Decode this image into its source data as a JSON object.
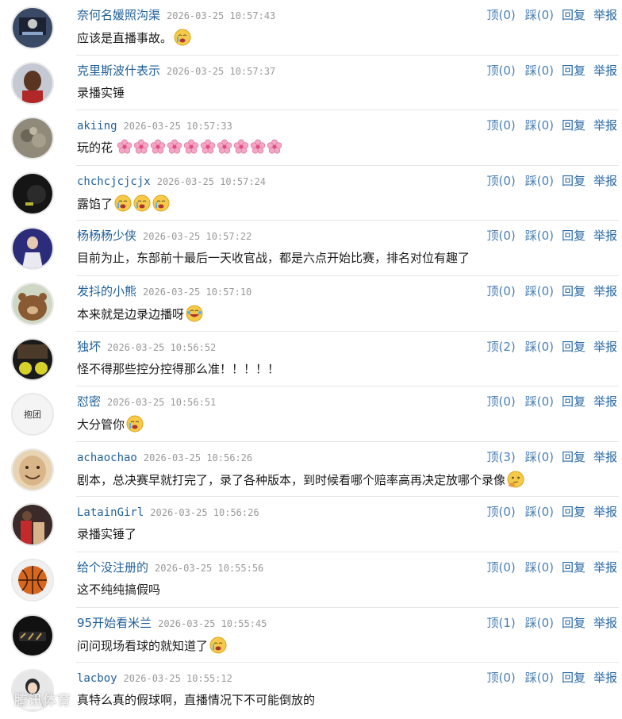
{
  "comments": [
    {
      "user": "奈何名媛照沟渠",
      "time": "2026-03-25 10:57:43",
      "text": "应该是直播事故。",
      "up": "顶(0)",
      "down": "踩(0)",
      "reply": "回复",
      "report": "举报"
    },
    {
      "user": "克里斯波什表示",
      "time": "2026-03-25 10:57:37",
      "text": "录播实锤",
      "up": "顶(0)",
      "down": "踩(0)",
      "reply": "回复",
      "report": "举报"
    },
    {
      "user": "akiing",
      "time": "2026-03-25 10:57:33",
      "text": "玩的花",
      "up": "顶(0)",
      "down": "踩(0)",
      "reply": "回复",
      "report": "举报"
    },
    {
      "user": "chchcjcjcjx",
      "time": "2026-03-25 10:57:24",
      "text": "露馅了",
      "up": "顶(0)",
      "down": "踩(0)",
      "reply": "回复",
      "report": "举报"
    },
    {
      "user": "杨杨杨少侠",
      "time": "2026-03-25 10:57:22",
      "text": "目前为止，东部前十最后一天收官战，都是六点开始比赛，排名对位有趣了",
      "up": "顶(0)",
      "down": "踩(0)",
      "reply": "回复",
      "report": "举报"
    },
    {
      "user": "发抖的小熊",
      "time": "2026-03-25 10:57:10",
      "text": "本来就是边录边播呀",
      "up": "顶(0)",
      "down": "踩(0)",
      "reply": "回复",
      "report": "举报"
    },
    {
      "user": "独坏",
      "time": "2026-03-25 10:56:52",
      "text": "怪不得那些控分控得那么准！！！！！",
      "up": "顶(2)",
      "down": "踩(0)",
      "reply": "回复",
      "report": "举报"
    },
    {
      "user": "怼密",
      "time": "2026-03-25 10:56:51",
      "text": "大分管你",
      "up": "顶(0)",
      "down": "踩(0)",
      "reply": "回复",
      "report": "举报",
      "avatar_text": "抱团"
    },
    {
      "user": "achaochao",
      "time": "2026-03-25 10:56:26",
      "text": "剧本，总决赛早就打完了，录了各种版本，到时候看哪个赔率高再决定放哪个录像",
      "up": "顶(3)",
      "down": "踩(0)",
      "reply": "回复",
      "report": "举报"
    },
    {
      "user": "LatainGirl",
      "time": "2026-03-25 10:56:26",
      "text": "录播实锤了",
      "up": "顶(0)",
      "down": "踩(0)",
      "reply": "回复",
      "report": "举报"
    },
    {
      "user": "给个没注册的",
      "time": "2026-03-25 10:55:56",
      "text": "这不纯纯搞假吗",
      "up": "顶(0)",
      "down": "踩(0)",
      "reply": "回复",
      "report": "举报"
    },
    {
      "user": "95开始看米兰",
      "time": "2026-03-25 10:55:45",
      "text": "问问现场看球的就知道了",
      "up": "顶(1)",
      "down": "踩(0)",
      "reply": "回复",
      "report": "举报"
    },
    {
      "user": "lacboy",
      "time": "2026-03-25 10:55:12",
      "text": "真特么真的假球啊，直播情况下不可能倒放的",
      "up": "顶(0)",
      "down": "踩(0)",
      "reply": "回复",
      "report": "举报"
    }
  ],
  "watermark": "腾讯体育",
  "colors": {
    "username": "#1f5f98",
    "action": "#2a6aa6",
    "time": "#999999",
    "separator": "#e6e6e6"
  }
}
